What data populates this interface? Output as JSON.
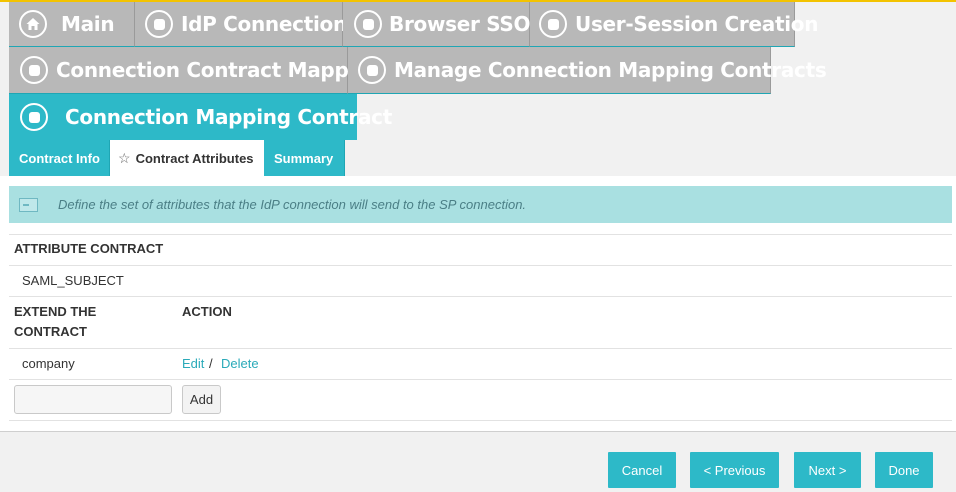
{
  "breadcrumbs": [
    {
      "label": "Main",
      "icon": "home-icon"
    },
    {
      "label": "IdP Connection",
      "icon": "circle-dot-icon"
    },
    {
      "label": "Browser SSO",
      "icon": "circle-dot-icon"
    },
    {
      "label": "User-Session Creation",
      "icon": "circle-dot-icon"
    },
    {
      "label": "Connection Contract Mapping",
      "icon": "circle-dot-icon"
    },
    {
      "label": "Manage Connection Mapping Contracts",
      "icon": "circle-dot-icon"
    },
    {
      "label": "Connection Mapping Contract",
      "icon": "circle-dot-icon",
      "active": true
    }
  ],
  "subtabs": [
    {
      "label": "Contract Info",
      "selected": false
    },
    {
      "label": "Contract Attributes",
      "selected": true,
      "icon": "star-icon"
    },
    {
      "label": "Summary",
      "selected": false
    }
  ],
  "info": {
    "text": "Define the set of attributes that the IdP connection will send to the SP connection."
  },
  "attribute_contract": {
    "header": "ATTRIBUTE CONTRACT",
    "items": [
      "SAML_SUBJECT"
    ]
  },
  "extend": {
    "headers": {
      "extend_line1": "EXTEND THE",
      "extend_line2": "CONTRACT",
      "action": "ACTION"
    },
    "rows": [
      {
        "name": "company",
        "edit": "Edit",
        "separator": "/",
        "delete": "Delete"
      }
    ],
    "input_value": "",
    "add_label": "Add"
  },
  "footer": {
    "cancel": "Cancel",
    "previous": "< Previous",
    "next": "Next >",
    "done": "Done"
  },
  "colors": {
    "accent": "#2db9c8",
    "crumb_gray": "#b8b8b8",
    "info_bg": "#a9e0e1",
    "top_border": "#f3c300",
    "link": "#2aaab9"
  }
}
